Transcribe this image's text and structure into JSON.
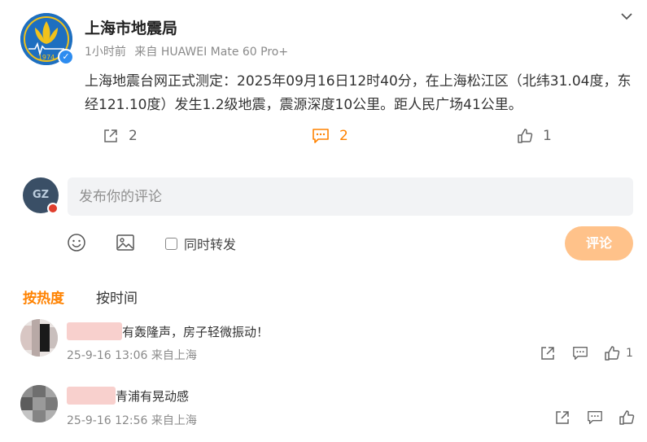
{
  "post": {
    "author_name": "上海市地震局",
    "avatar_logo_text": "1974",
    "verified_mark": "✓",
    "time_ago": "1小时前",
    "source": "来自 HUAWEI Mate 60 Pro+",
    "text": "上海地震台网正式测定：2025年09月16日12时40分，在上海松江区（北纬31.04度，东经121.10度）发生1.2级地震，震源深度10公里。距人民广场41公里。",
    "repost_count": "2",
    "comment_count": "2",
    "like_count": "1"
  },
  "composer": {
    "avatar_text": "GZ",
    "placeholder": "发布你的评论",
    "value": "",
    "repost_label": "同时转发",
    "repost_checked": false,
    "submit_label": "评论"
  },
  "sort_tabs": [
    {
      "label": "按热度",
      "active": true
    },
    {
      "label": "按时间",
      "active": false
    }
  ],
  "comments": [
    {
      "text": "有轰隆声，房子轻微振动！",
      "timestamp": "25-9-16 13:06",
      "location": "来自上海",
      "like_count": "1"
    },
    {
      "text": "青浦有晃动感",
      "timestamp": "25-9-16 12:56",
      "location": "来自上海",
      "like_count": ""
    }
  ],
  "colors": {
    "accent": "#ff8200",
    "submit_disabled": "#ffc28a",
    "verified": "#2d8cf0",
    "input_bg": "#f2f3f5",
    "muted_text": "#8a8a8a"
  },
  "icons": {
    "collapse": "chevron-down-icon",
    "repost": "share-icon",
    "comment": "comment-icon",
    "like": "thumbs-up-icon",
    "emoji": "smiley-icon",
    "image": "image-icon"
  }
}
